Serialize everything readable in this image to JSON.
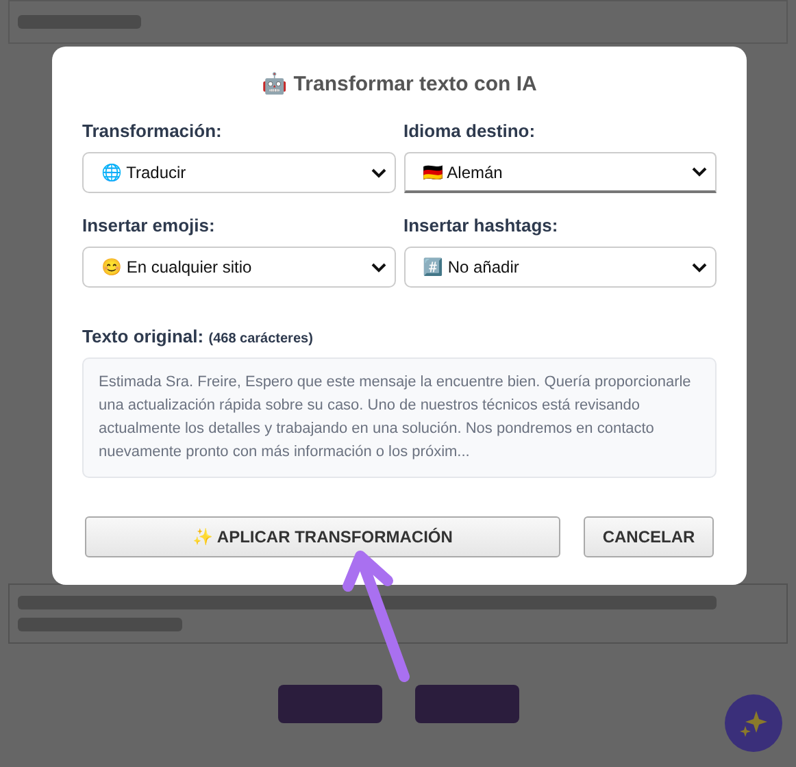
{
  "dialog": {
    "title": "🤖 Transformar texto con IA",
    "fields": [
      {
        "label": "Transformación:",
        "value": "🌐 Traducir",
        "focused": false
      },
      {
        "label": "Idioma destino:",
        "value": "🇩🇪 Alemán",
        "focused": true
      },
      {
        "label": "Insertar emojis:",
        "value": "😊 En cualquier sitio",
        "focused": false
      },
      {
        "label": "Insertar hashtags:",
        "value": "#️⃣ No añadir",
        "focused": false
      }
    ],
    "original_label": "Texto original:",
    "original_count": "(468 carácteres)",
    "original_text": "Estimada Sra. Freire, Espero que este mensaje la encuentre bien. Quería proporcionarle una actualización rápida sobre su caso. Uno de nuestros técnicos está revisando actualmente los detalles y trabajando en una solución. Nos pondremos en contacto nuevamente pronto con más información o los próxim...",
    "buttons": [
      {
        "label": "✨ APLICAR TRANSFORMACIÓN",
        "kind": "primary"
      },
      {
        "label": "CANCELAR",
        "kind": "secondary"
      }
    ]
  }
}
